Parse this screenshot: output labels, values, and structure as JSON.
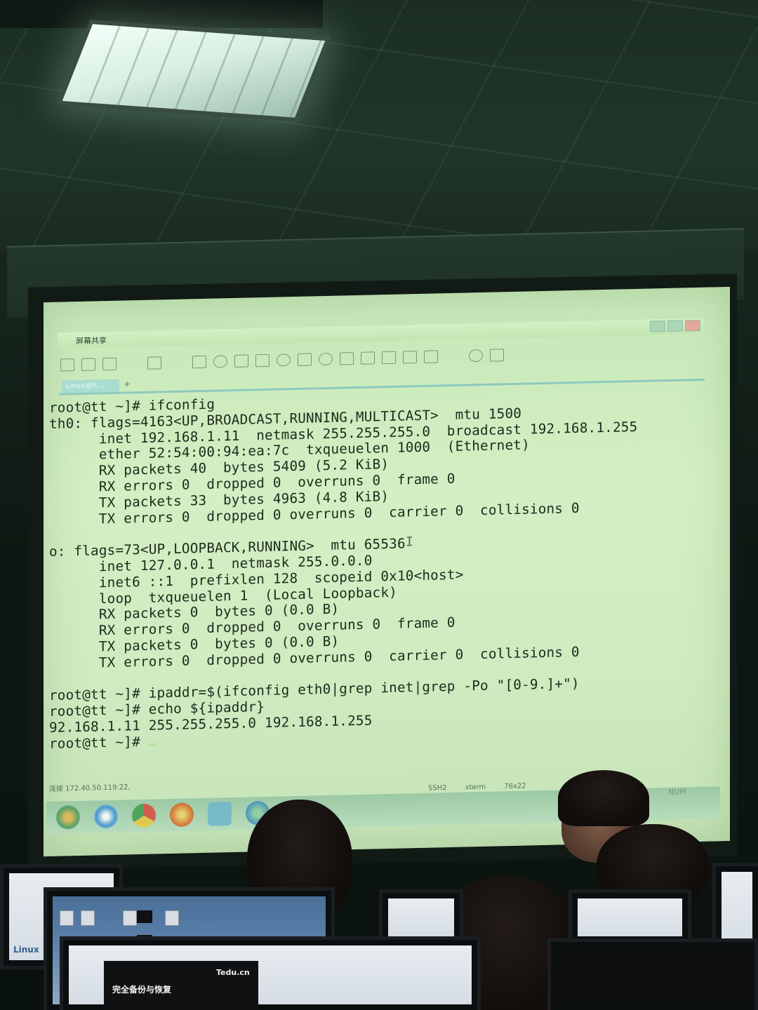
{
  "window": {
    "title": "屏幕共享",
    "tab_label": "Linux@tt..."
  },
  "terminal": {
    "lines": [
      "root@tt ~]# ifconfig",
      "th0: flags=4163<UP,BROADCAST,RUNNING,MULTICAST>  mtu 1500",
      "      inet 192.168.1.11  netmask 255.255.255.0  broadcast 192.168.1.255",
      "      ether 52:54:00:94:ea:7c  txqueuelen 1000  (Ethernet)",
      "      RX packets 40  bytes 5409 (5.2 KiB)",
      "      RX errors 0  dropped 0  overruns 0  frame 0",
      "      TX packets 33  bytes 4963 (4.8 KiB)",
      "      TX errors 0  dropped 0 overruns 0  carrier 0  collisions 0",
      "",
      "o: flags=73<UP,LOOPBACK,RUNNING>  mtu 65536",
      "      inet 127.0.0.1  netmask 255.0.0.0",
      "      inet6 ::1  prefixlen 128  scopeid 0x10<host>",
      "      loop  txqueuelen 1  (Local Loopback)",
      "      RX packets 0  bytes 0 (0.0 B)",
      "      RX errors 0  dropped 0  overruns 0  frame 0",
      "      TX packets 0  bytes 0 (0.0 B)",
      "      TX errors 0  dropped 0 overruns 0  carrier 0  collisions 0",
      "",
      "root@tt ~]# ipaddr=$(ifconfig eth0|grep inet|grep -Po \"[0-9.]+\")",
      "root@tt ~]# echo ${ipaddr}",
      "92.168.1.11 255.255.255.0 192.168.1.255",
      "root@tt ~]# "
    ]
  },
  "statusbar": {
    "connection": "连接 172.40.50.119:22,",
    "protocol": "SSH2",
    "term": "xterm",
    "size": "76x22",
    "num": "NUM"
  },
  "monitor_text": {
    "brand": "Tedu.cn",
    "slide_title": "完全备份与恢复",
    "side_label": "Linux"
  },
  "colors": {
    "screen_bg": "#cfebc0",
    "terminal_text": "#1d2b1c",
    "tab_accent": "#8ec9c0"
  }
}
